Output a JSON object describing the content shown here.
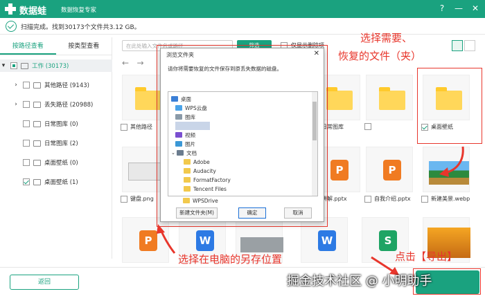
{
  "app": {
    "name": "数据蛙",
    "subtitle": "数据恢复专家"
  },
  "status": {
    "text": "扫描完成。找到30173个文件共3.12 GB。"
  },
  "sidebar": {
    "tabs": [
      "按路径查看",
      "按类型查看"
    ],
    "tree": [
      {
        "label": "工作 (30173)",
        "state": "partial",
        "level": 0
      },
      {
        "label": "其他路径 (9143)",
        "state": "off",
        "level": 1
      },
      {
        "label": "丢失路径 (20988)",
        "state": "off",
        "level": 1
      },
      {
        "label": "日常图库 (0)",
        "state": "off",
        "level": 1
      },
      {
        "label": "日常图库 (2)",
        "state": "off",
        "level": 1
      },
      {
        "label": "桌面壁纸 (0)",
        "state": "off",
        "level": 1
      },
      {
        "label": "桌面壁纸 (1)",
        "state": "on",
        "level": 1
      }
    ]
  },
  "toolbar": {
    "search_placeholder": "在此处输入文件名或路径",
    "filter_label": "筛选",
    "only_deleted": "仅显示删除项"
  },
  "grid": {
    "row1": [
      "其他路径",
      "",
      "",
      "日常图库",
      "",
      "桌面壁纸"
    ],
    "row2": [
      "键盘.png",
      "",
      "",
      "讲解.pptx",
      "自我介绍.pptx",
      "新建美景.webp"
    ]
  },
  "dialog": {
    "title": "浏览文件夹",
    "close": "✕",
    "description": "请你将需要恢复的文件保存到原丢失数据的磁盘。",
    "tree": [
      "桌面",
      "WPS云盘",
      "图库",
      "",
      "视频",
      "图片",
      "文档",
      "Adobe",
      "Audacity",
      "FormatFactory",
      "Tencent Files",
      "WPSDrive"
    ],
    "new_folder": "新建文件夹(M)",
    "ok": "确定",
    "cancel": "取消"
  },
  "bottom": {
    "back": "返回"
  },
  "annotations": {
    "select_top": "选择需要、",
    "select_bottom": "恢复的文件（夹）",
    "choose_location": "选择在电脑的另存位置",
    "click_export": "点击【导出】"
  },
  "watermark": "掘金技术社区 @ 小明助手",
  "colors": {
    "brand": "#1aa27f",
    "annotation": "#e8362c"
  }
}
